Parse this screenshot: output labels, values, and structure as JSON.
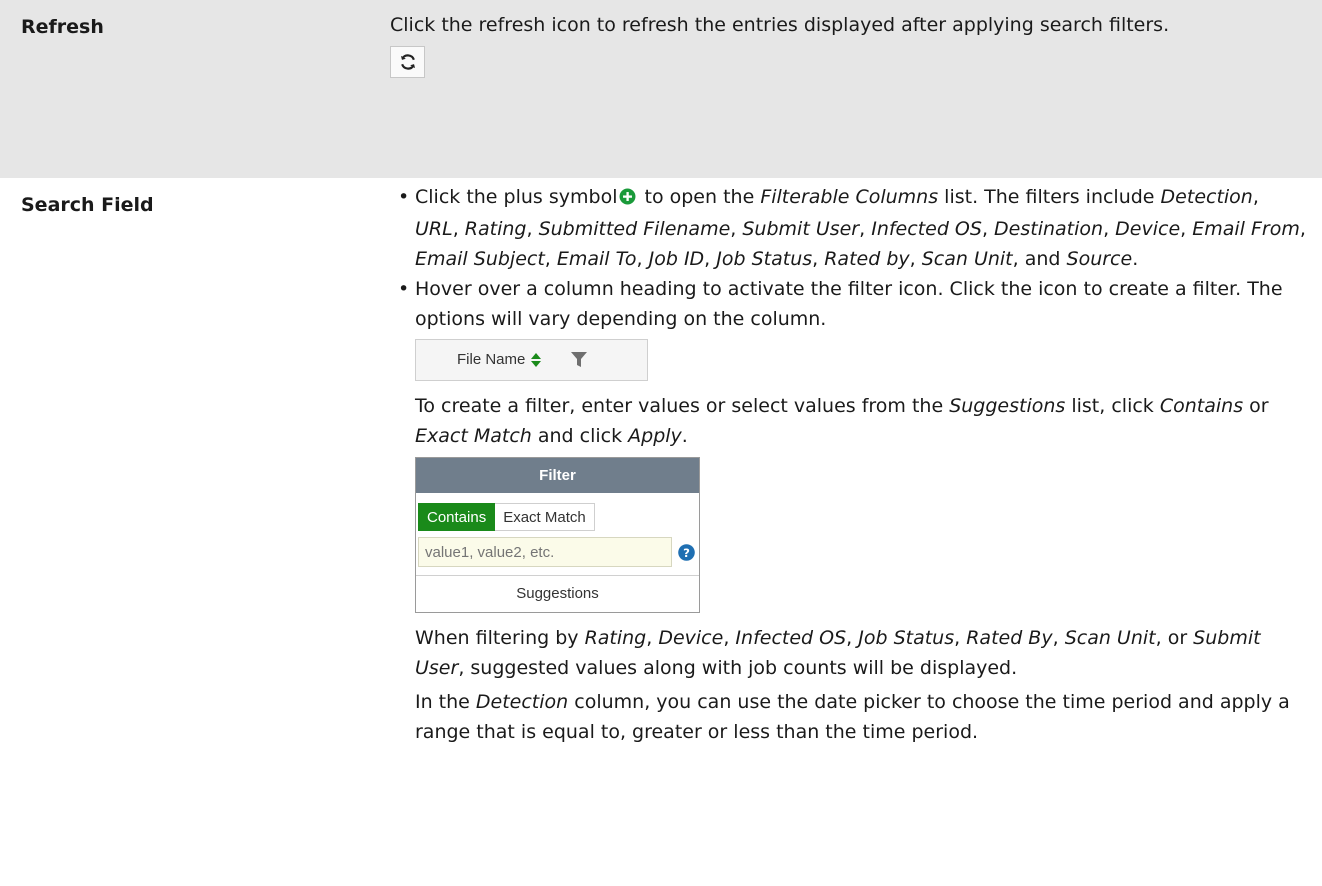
{
  "refresh": {
    "term": "Refresh",
    "desc": "Click the refresh icon to refresh the entries displayed after applying search filters.",
    "icon": "refresh-icon"
  },
  "search": {
    "term": "Search Field",
    "b1": {
      "t1": "Click the plus symbol",
      "t2": " to open the ",
      "fc": "Filterable Columns",
      "t3": " list. The filters include ",
      "filters": [
        "Detection",
        "URL",
        "Rating",
        "Submitted Filename",
        "Submit User",
        "Infected OS",
        "Destination",
        "Device",
        "Email From",
        "Email Subject",
        "Email To",
        "Job ID",
        "Job Status",
        "Rated by",
        "Scan Unit"
      ],
      "and": ", and ",
      "last": "Source",
      "end": "."
    },
    "b2": "Hover over a column heading to activate the filter icon. Click the icon to create a filter. The options will vary depending on the column.",
    "file_name_header": "File Name",
    "p1": {
      "t1": "To create a filter, enter values or select values from the ",
      "s": "Suggestions",
      "t2": " list, click ",
      "c": "Contains",
      "t3": " or ",
      "e": "Exact Match",
      "t4": " and click ",
      "a": "Apply",
      "t5": "."
    },
    "filter_popup": {
      "title": "Filter",
      "tab_contains": "Contains",
      "tab_exact": "Exact Match",
      "placeholder": "value1, value2, etc.",
      "suggestions": "Suggestions"
    },
    "p2": {
      "t1": "When filtering by ",
      "i1": "Rating",
      "i2": "Device",
      "i3": "Infected OS",
      "i4": "Job Status",
      "i5": "Rated By",
      "i6": "Scan Unit",
      "or": ", or ",
      "i7": "Submit User",
      "t2": ", suggested values along with job counts will be displayed."
    },
    "p3": {
      "t1": "In the ",
      "d": "Detection",
      "t2": " column, you can use the date picker to choose the time period and apply a range that is equal to, greater or less than the time period."
    }
  },
  "colors": {
    "refresh_row_bg": "#e6e6e6",
    "filter_header_bg": "#707e8c",
    "contains_tab_bg": "#1a8a1a",
    "plus_icon": "#1a9a3a",
    "help_icon": "#1f6fb2"
  }
}
